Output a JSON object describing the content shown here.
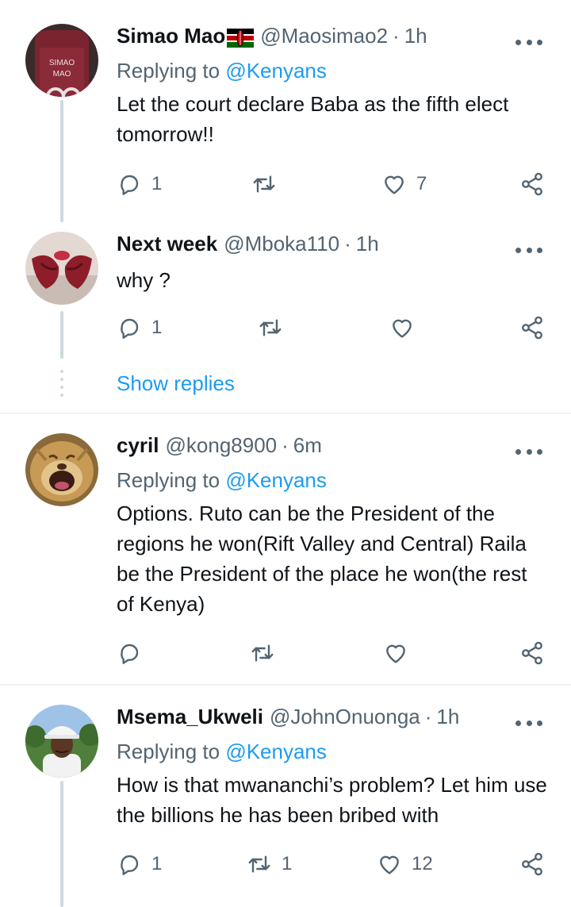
{
  "tweets": [
    {
      "name": "Simao Mao",
      "handle": "@Maosimao2",
      "time": "1h",
      "replying_label": "Replying to",
      "replying_to": "@Kenyans",
      "text": "Let the court declare Baba as the fifth elect tomorrow!!",
      "reply_count": "1",
      "retweet_count": "",
      "like_count": "7",
      "avatar_text_1": "SIMAO",
      "avatar_text_2": "MAO"
    },
    {
      "name": "Next week",
      "handle": "@Mboka110",
      "time": "1h",
      "text": "why ?",
      "reply_count": "1",
      "retweet_count": "",
      "like_count": ""
    },
    {
      "name": "cyril",
      "handle": "@kong8900",
      "time": "6m",
      "replying_label": "Replying to",
      "replying_to": "@Kenyans",
      "text": "Options. Ruto can be the President of the regions he won(Rift Valley and Central) Raila be the President of the place he won(the rest of Kenya)",
      "reply_count": "",
      "retweet_count": "",
      "like_count": ""
    },
    {
      "name": "Msema_Ukweli",
      "handle": "@JohnOnuonga",
      "time": "1h",
      "replying_label": "Replying to",
      "replying_to": "@Kenyans",
      "text": "How is that mwananchi’s problem? Let him use the billions he has been bribed with",
      "reply_count": "1",
      "retweet_count": "1",
      "like_count": "12"
    }
  ],
  "show_replies_label": "Show replies",
  "separator": "·",
  "icons": {
    "reply": "reply-icon",
    "retweet": "retweet-icon",
    "like": "heart-icon",
    "share": "share-icon",
    "more": "more-icon",
    "flag": "kenya-flag-icon"
  },
  "colors": {
    "link": "#1d9bf0",
    "secondary_text": "#536471",
    "thread_line": "#cfd9de"
  }
}
